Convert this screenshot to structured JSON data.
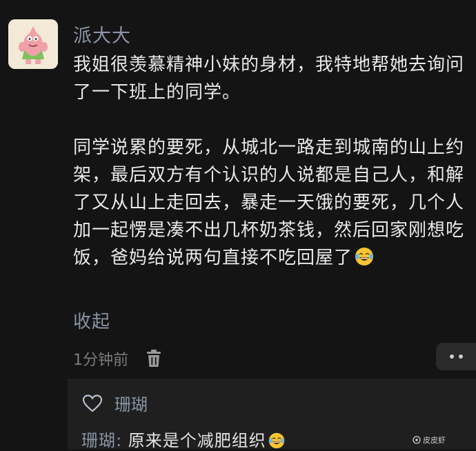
{
  "comment": {
    "author": "派大大",
    "paragraphs": [
      "我姐很羡慕精神小妹的身材，我特地帮她去询问了一下班上的同学。",
      "同学说累的要死，从城北一路走到城南的山上约架，最后双方有个认识的人说都是自己人，和解了又从山上走回去，暴走一天饿的要死，几个人加一起愣是凑不出几杯奶茶钱，然后回家刚想吃饭，爸妈给说两句直接不吃回屋了"
    ],
    "paragraph_end_emoji": "laughing-tears-emoji",
    "collapse_label": "收起",
    "time": "1分钟前"
  },
  "reply_section": {
    "liked_by": "珊瑚",
    "reply_author": "珊瑚",
    "reply_separator": ": ",
    "reply_text": "原来是个减肥组织",
    "reply_emoji": "laughing-tears-emoji"
  },
  "watermark": "皮皮虾",
  "colors": {
    "background": "#141414",
    "name_accent": "#8a95a6",
    "text": "#e9e9e9",
    "panel": "#1f1f1f"
  }
}
